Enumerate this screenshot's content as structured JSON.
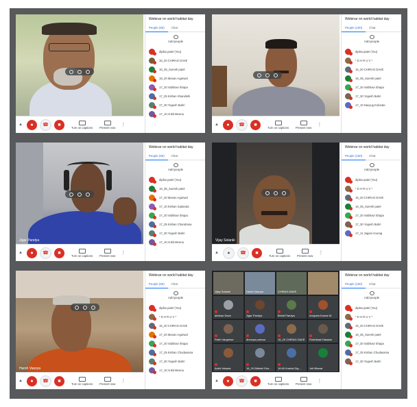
{
  "panels": [
    {
      "meeting_title": "Webinar on world habitat day",
      "people_tab": "People (50)",
      "chat_tab": "Chat",
      "add_people": "Add people",
      "captions_label": "Turn on captions",
      "present_label": "Present now",
      "participant_name": "",
      "participants": [
        "dipika patel (You)",
        "15_20 CHIRAG DAVE",
        "16_35_Suresh patel",
        "18_20 Manan Agarwal",
        "17_20 Vaibhavi Shapa",
        "17_25 Kishan Shandishi",
        "17_30 Yogesh Bahri",
        "17_10 Ankit Meena"
      ]
    },
    {
      "meeting_title": "Webinar on world habitat day",
      "people_tab": "People (100)",
      "chat_tab": "Chat",
      "add_people": "Add people",
      "captions_label": "Turn on captions",
      "present_label": "Present now",
      "participant_name": "",
      "participants": [
        "dipika patel (You)",
        "* D H R U V *",
        "15_20 CHIRAG DAVE",
        "16_35_Suresh patel",
        "17_20 Vaibhavi Shapa",
        "17_30 Yogesh Bahri",
        "17_10 Navyug Kolorate"
      ]
    },
    {
      "meeting_title": "Webinar on world habitat day",
      "people_tab": "People (50)",
      "chat_tab": "Chat",
      "add_people": "Add people",
      "captions_label": "Turn on captions",
      "present_label": "Present now",
      "participant_name": "Jigar Pandya",
      "participants": [
        "dipika patel (You)",
        "16_35_Suresh patel",
        "17_20 Manan Agarwal",
        "17_10 Kishan Sadanda",
        "17_20 Vaibhavi Shapa",
        "17_25 Kishan Chandrana",
        "17_30 Yogesh Bahri",
        "17_10 Ankit Meena"
      ]
    },
    {
      "meeting_title": "Webinar on world habitat day",
      "people_tab": "People (100)",
      "chat_tab": "Chat",
      "add_people": "Add people",
      "captions_label": "Turn on captions",
      "present_label": "Present now",
      "participant_name": "Vijay Solanki",
      "participants": [
        "dipika patel (You)",
        "* D H R U V *",
        "15_20 CHIRAG DAVE",
        "16_35_Suresh patel",
        "17_20 Vaibhavi Shapa",
        "17_30 Yogesh Bahri",
        "17_11 Jagani Anurag"
      ]
    },
    {
      "meeting_title": "Webinar on world habitat day",
      "people_tab": "People (50)",
      "chat_tab": "Chat",
      "add_people": "Add people",
      "captions_label": "Turn on captions",
      "present_label": "Present now",
      "participant_name": "Harsh Vasoya",
      "participants": [
        "dipika patel (You)",
        "* D H R U V *",
        "15_20 CHIRAG DAVE",
        "17_20 Manan Agarwal",
        "17_20 Vaibhavi Shapa",
        "17_25 Kishan Chudasama",
        "17_30 Yogesh Bahri",
        "17_10 Ankit Meena"
      ]
    },
    {
      "meeting_title": "Webinar on world habitat day",
      "people_tab": "People (100)",
      "chat_tab": "Chat",
      "add_people": "Add people",
      "captions_label": "Turn on captions",
      "present_label": "Present now",
      "participant_name": "",
      "participants": [
        "dipika patel (You)",
        "* D H R U V *",
        "15_20 CHIRAG DAVE",
        "16_35_Suresh patel",
        "17_20 Vaibhavi Shapa",
        "17_25 Kishan Chudasama",
        "17_30 Yogesh Bahri"
      ],
      "grid_tiles": [
        "Vijay Solanki",
        "Harsh Vasoya",
        "CHIRAG DAVE",
        "",
        "abhirao Dave",
        "Jigar Pandya",
        "Bhinit Pandya",
        "Anupam Kumar M.",
        "Parth Varghese",
        "dhruvya parmar",
        "16_20 CHIRAG DAVE",
        "Rohinitaal Hasada",
        "Ankit Vekaria",
        "16_20 Bhibati Gho...",
        "16:40 Kushal Dig...",
        "Jolt Bharat"
      ]
    }
  ],
  "colors": {
    "accent_blue": "#1a73e8",
    "end_call_red": "#d93025",
    "frame_gray": "#58595b"
  }
}
